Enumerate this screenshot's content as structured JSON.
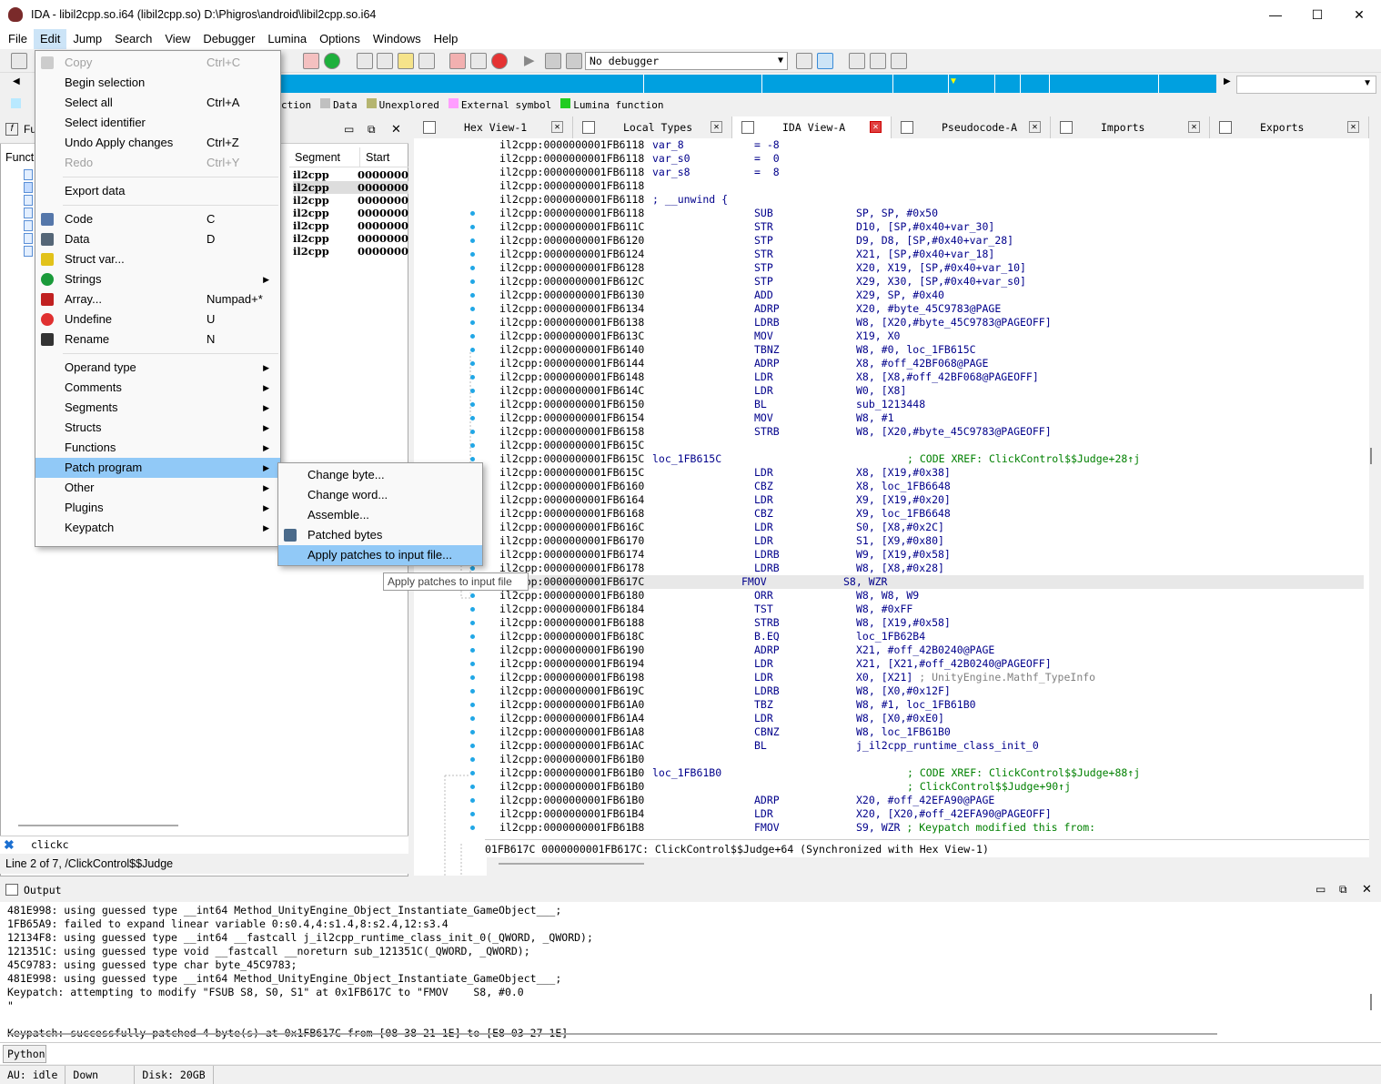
{
  "window": {
    "title": "IDA - libil2cpp.so.i64 (libil2cpp.so) D:\\Phigros\\android\\libil2cpp.so.i64"
  },
  "menubar": [
    "File",
    "Edit",
    "Jump",
    "Search",
    "View",
    "Debugger",
    "Lumina",
    "Options",
    "Windows",
    "Help"
  ],
  "toolbar": {
    "debugger": "No debugger"
  },
  "legend": [
    {
      "label": "ction",
      "color": "#ffffff"
    },
    {
      "label": "Data",
      "color": "#c0c0c0"
    },
    {
      "label": "Unexplored",
      "color": "#b5b570"
    },
    {
      "label": "External symbol",
      "color": "#ff9eff"
    },
    {
      "label": "Lumina function",
      "color": "#22cc22"
    }
  ],
  "left_pane": {
    "header": "Fu",
    "col_label": "Funct",
    "columns": [
      "Segment",
      "Start"
    ],
    "rows": [
      {
        "seg": "il2cpp",
        "start": "0000000"
      },
      {
        "seg": "il2cpp",
        "start": "0000000"
      },
      {
        "seg": "il2cpp",
        "start": "0000000"
      },
      {
        "seg": "il2cpp",
        "start": "0000000"
      },
      {
        "seg": "il2cpp",
        "start": "0000000"
      },
      {
        "seg": "il2cpp",
        "start": "0000000"
      },
      {
        "seg": "il2cpp",
        "start": "0000000"
      }
    ],
    "filter": "clickc",
    "line_info": "Line 2 of 7, /ClickControl$$Judge"
  },
  "tabs": [
    {
      "label": "Hex View-1",
      "active": false
    },
    {
      "label": "Local Types",
      "active": false
    },
    {
      "label": "IDA View-A",
      "active": true
    },
    {
      "label": "Pseudocode-A",
      "active": false
    },
    {
      "label": "Imports",
      "active": false
    },
    {
      "label": "Exports",
      "active": false
    }
  ],
  "disasm": [
    {
      "a": "il2cpp:0000000001FB6118",
      "l": "var_8",
      "eq": "= -8"
    },
    {
      "a": "il2cpp:0000000001FB6118",
      "l": "var_s0",
      "eq": "=  0"
    },
    {
      "a": "il2cpp:0000000001FB6118",
      "l": "var_s8",
      "eq": "=  8"
    },
    {
      "a": "il2cpp:0000000001FB6118"
    },
    {
      "a": "il2cpp:0000000001FB6118",
      "c": "; __unwind {"
    },
    {
      "a": "il2cpp:0000000001FB6118",
      "m": "SUB",
      "o": "SP, SP, #0x50"
    },
    {
      "a": "il2cpp:0000000001FB611C",
      "m": "STR",
      "o": "D10, [SP,#0x40+var_30]"
    },
    {
      "a": "il2cpp:0000000001FB6120",
      "m": "STP",
      "o": "D9, D8, [SP,#0x40+var_28]"
    },
    {
      "a": "il2cpp:0000000001FB6124",
      "m": "STR",
      "o": "X21, [SP,#0x40+var_18]"
    },
    {
      "a": "il2cpp:0000000001FB6128",
      "m": "STP",
      "o": "X20, X19, [SP,#0x40+var_10]"
    },
    {
      "a": "il2cpp:0000000001FB612C",
      "m": "STP",
      "o": "X29, X30, [SP,#0x40+var_s0]"
    },
    {
      "a": "il2cpp:0000000001FB6130",
      "m": "ADD",
      "o": "X29, SP, #0x40"
    },
    {
      "a": "il2cpp:0000000001FB6134",
      "m": "ADRP",
      "o": "X20, #byte_45C9783@PAGE"
    },
    {
      "a": "il2cpp:0000000001FB6138",
      "m": "LDRB",
      "o": "W8, [X20,#byte_45C9783@PAGEOFF]"
    },
    {
      "a": "il2cpp:0000000001FB613C",
      "m": "MOV",
      "o": "X19, X0"
    },
    {
      "a": "il2cpp:0000000001FB6140",
      "m": "TBNZ",
      "o": "W8, #0, loc_1FB615C"
    },
    {
      "a": "il2cpp:0000000001FB6144",
      "m": "ADRP",
      "o": "X8, #off_42BF068@PAGE"
    },
    {
      "a": "il2cpp:0000000001FB6148",
      "m": "LDR",
      "o": "X8, [X8,#off_42BF068@PAGEOFF]"
    },
    {
      "a": "il2cpp:0000000001FB614C",
      "m": "LDR",
      "o": "W0, [X8]"
    },
    {
      "a": "il2cpp:0000000001FB6150",
      "m": "BL",
      "o": "sub_1213448"
    },
    {
      "a": "il2cpp:0000000001FB6154",
      "m": "MOV",
      "o": "W8, #1"
    },
    {
      "a": "il2cpp:0000000001FB6158",
      "m": "STRB",
      "o": "W8, [X20,#byte_45C9783@PAGEOFF]"
    },
    {
      "a": "il2cpp:0000000001FB615C"
    },
    {
      "a": "il2cpp:0000000001FB615C",
      "l": "loc_1FB615C",
      "xr": "; CODE XREF: ClickControl$$Judge+28↑j"
    },
    {
      "a": "il2cpp:0000000001FB615C",
      "m": "LDR",
      "o": "X8, [X19,#0x38]"
    },
    {
      "a": "il2cpp:0000000001FB6160",
      "m": "CBZ",
      "o": "X8, loc_1FB6648"
    },
    {
      "a": "il2cpp:0000000001FB6164",
      "m": "LDR",
      "o": "X9, [X19,#0x20]"
    },
    {
      "a": "il2cpp:0000000001FB6168",
      "m": "CBZ",
      "o": "X9, loc_1FB6648"
    },
    {
      "a": "il2cpp:0000000001FB616C",
      "m": "LDR",
      "o": "S0, [X8,#0x2C]"
    },
    {
      "a": "il2cpp:0000000001FB6170",
      "m": "LDR",
      "o": "S1, [X9,#0x80]"
    },
    {
      "a": "il2cpp:0000000001FB6174",
      "m": "LDRB",
      "o": "W9, [X19,#0x58]"
    },
    {
      "a": "il2cpp:0000000001FB6178",
      "m": "LDRB",
      "o": "W8, [X8,#0x28]"
    },
    {
      "a": "il2cpp:0000000001FB617C",
      "m": "FMOV",
      "o": "S8, WZR",
      "hl": true
    },
    {
      "a": "il2cpp:0000000001FB6180",
      "m": "ORR",
      "o": "W8, W8, W9"
    },
    {
      "a": "il2cpp:0000000001FB6184",
      "m": "TST",
      "o": "W8, #0xFF"
    },
    {
      "a": "il2cpp:0000000001FB6188",
      "m": "STRB",
      "o": "W8, [X19,#0x58]"
    },
    {
      "a": "il2cpp:0000000001FB618C",
      "m": "B.EQ",
      "o": "loc_1FB62B4"
    },
    {
      "a": "il2cpp:0000000001FB6190",
      "m": "ADRP",
      "o": "X21, #off_42B0240@PAGE"
    },
    {
      "a": "il2cpp:0000000001FB6194",
      "m": "LDR",
      "o": "X21, [X21,#off_42B0240@PAGEOFF]"
    },
    {
      "a": "il2cpp:0000000001FB6198",
      "m": "LDR",
      "o": "X0, [X21]",
      "g": " ; UnityEngine.Mathf_TypeInfo"
    },
    {
      "a": "il2cpp:0000000001FB619C",
      "m": "LDRB",
      "o": "W8, [X0,#0x12F]"
    },
    {
      "a": "il2cpp:0000000001FB61A0",
      "m": "TBZ",
      "o": "W8, #1, loc_1FB61B0"
    },
    {
      "a": "il2cpp:0000000001FB61A4",
      "m": "LDR",
      "o": "W8, [X0,#0xE0]"
    },
    {
      "a": "il2cpp:0000000001FB61A8",
      "m": "CBNZ",
      "o": "W8, loc_1FB61B0"
    },
    {
      "a": "il2cpp:0000000001FB61AC",
      "m": "BL",
      "o": "j_il2cpp_runtime_class_init_0"
    },
    {
      "a": "il2cpp:0000000001FB61B0"
    },
    {
      "a": "il2cpp:0000000001FB61B0",
      "l": "loc_1FB61B0",
      "xr": "; CODE XREF: ClickControl$$Judge+88↑j"
    },
    {
      "a": "il2cpp:0000000001FB61B0",
      "xr": "; ClickControl$$Judge+90↑j"
    },
    {
      "a": "il2cpp:0000000001FB61B0",
      "m": "ADRP",
      "o": "X20, #off_42EFA90@PAGE"
    },
    {
      "a": "il2cpp:0000000001FB61B4",
      "m": "LDR",
      "o": "X20, [X20,#off_42EFA90@PAGEOFF]"
    },
    {
      "a": "il2cpp:0000000001FB61B8",
      "m": "FMOV",
      "o": "S9, WZR",
      "c2": " ; Keypatch modified this from:"
    }
  ],
  "disasm_status": "01FB617C 0000000001FB617C: ClickControl$$Judge+64 (Synchronized with Hex View-1)",
  "output": {
    "title": "Output",
    "lines": [
      "481E998: using guessed type __int64 Method_UnityEngine_Object_Instantiate_GameObject___;",
      "1FB65A9: failed to expand linear variable 0:s0.4,4:s1.4,8:s2.4,12:s3.4",
      "12134F8: using guessed type __int64 __fastcall j_il2cpp_runtime_class_init_0(_QWORD, _QWORD);",
      "121351C: using guessed type void __fastcall __noreturn sub_121351C(_QWORD, _QWORD);",
      "45C9783: using guessed type char byte_45C9783;",
      "481E998: using guessed type __int64 Method_UnityEngine_Object_Instantiate_GameObject___;",
      "Keypatch: attempting to modify \"FSUB S8, S0, S1\" at 0x1FB617C to \"FMOV    S8, #0.0",
      "\"",
      "",
      "Keypatch: successfully patched 4 byte(s) at 0x1FB617C from [08 38 21 1E] to [E8 03 27 1E]"
    ]
  },
  "python_label": "Python",
  "statusbar": {
    "au": "AU:  idle",
    "dir": "Down",
    "disk": "Disk: 20GB"
  },
  "edit_menu": [
    {
      "label": "Copy",
      "sc": "Ctrl+C",
      "dis": true,
      "icon": "copy-icon"
    },
    {
      "label": "Begin selection"
    },
    {
      "label": "Select all",
      "sc": "Ctrl+A"
    },
    {
      "label": "Select identifier"
    },
    {
      "label": "Undo Apply changes",
      "sc": "Ctrl+Z"
    },
    {
      "label": "Redo",
      "sc": "Ctrl+Y",
      "dis": true
    },
    {
      "sep": true
    },
    {
      "label": "Export data"
    },
    {
      "sep": true
    },
    {
      "label": "Code",
      "sc": "C",
      "icon": "code-icon"
    },
    {
      "label": "Data",
      "sc": "D",
      "icon": "data-icon"
    },
    {
      "label": "Struct var...",
      "icon": "struct-icon"
    },
    {
      "label": "Strings",
      "sub": true,
      "icon": "strings-icon"
    },
    {
      "label": "Array...",
      "sc": "Numpad+*",
      "icon": "array-icon"
    },
    {
      "label": "Undefine",
      "sc": "U",
      "icon": "undefine-icon"
    },
    {
      "label": "Rename",
      "sc": "N",
      "icon": "rename-icon"
    },
    {
      "sep": true
    },
    {
      "label": "Operand type",
      "sub": true
    },
    {
      "label": "Comments",
      "sub": true
    },
    {
      "label": "Segments",
      "sub": true
    },
    {
      "label": "Structs",
      "sub": true
    },
    {
      "label": "Functions",
      "sub": true
    },
    {
      "label": "Patch program",
      "sub": true,
      "hov": true
    },
    {
      "label": "Other",
      "sub": true
    },
    {
      "label": "Plugins",
      "sub": true
    },
    {
      "label": "Keypatch",
      "sub": true
    }
  ],
  "patch_menu": [
    {
      "label": "Change byte..."
    },
    {
      "label": "Change word..."
    },
    {
      "label": "Assemble..."
    },
    {
      "label": "Patched bytes",
      "icon": "patched-bytes-icon"
    },
    {
      "label": "Apply patches to input file...",
      "hov": true
    }
  ],
  "tooltip": "Apply patches to input file"
}
